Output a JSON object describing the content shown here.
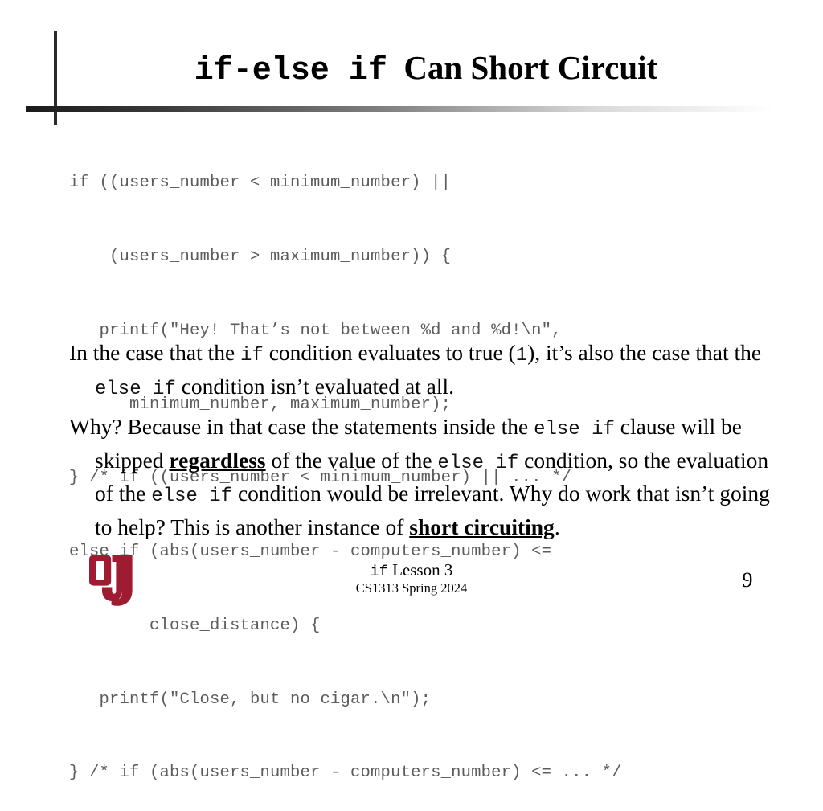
{
  "slide": {
    "title": {
      "mono_part": "if-else if",
      "serif_part": "Can Short Circuit"
    },
    "code_lines": [
      "if ((users_number < minimum_number) ||",
      "    (users_number > maximum_number)) {",
      "   printf(\"Hey! That’s not between %d and %d!\\n\",",
      "      minimum_number, maximum_number);",
      "} /* if ((users_number < minimum_number) || ... */",
      "else if (abs(users_number - computers_number) <=",
      "        close_distance) {",
      "   printf(\"Close, but no cigar.\\n\");",
      "} /* if (abs(users_number - computers_number) <= ... */"
    ],
    "paragraph1": {
      "t1": "In the case that the ",
      "code1": "if",
      "t2": " condition evaluates to true (",
      "code2": "1",
      "t3": "), it’s also the case that the ",
      "code3": "else if",
      "t4": " condition isn’t evaluated at all."
    },
    "paragraph2": {
      "t1": "Why? Because in that case the statements inside the ",
      "code1": "else if",
      "t2": " clause will be skipped ",
      "emph1": "regardless",
      "t3": " of the value of the ",
      "code2": "else if",
      "t4": " condition, so the evaluation of the ",
      "code3": "else if",
      "t5": " condition would be irrelevant. Why do work that isn’t going to help? This is another instance of ",
      "emph2": "short circuiting",
      "t6": "."
    },
    "footer": {
      "line1_mono": "if",
      "line1_serif": " Lesson 3",
      "line2": "CS1313 Spring 2024",
      "page_number": "9"
    },
    "colors": {
      "logo_crimson": "#9E1B32",
      "code_gray": "#5C5C5C",
      "rule_dark": "#1A1A1A"
    },
    "logo": {
      "name": "ou-logo",
      "letters": "OU"
    }
  }
}
